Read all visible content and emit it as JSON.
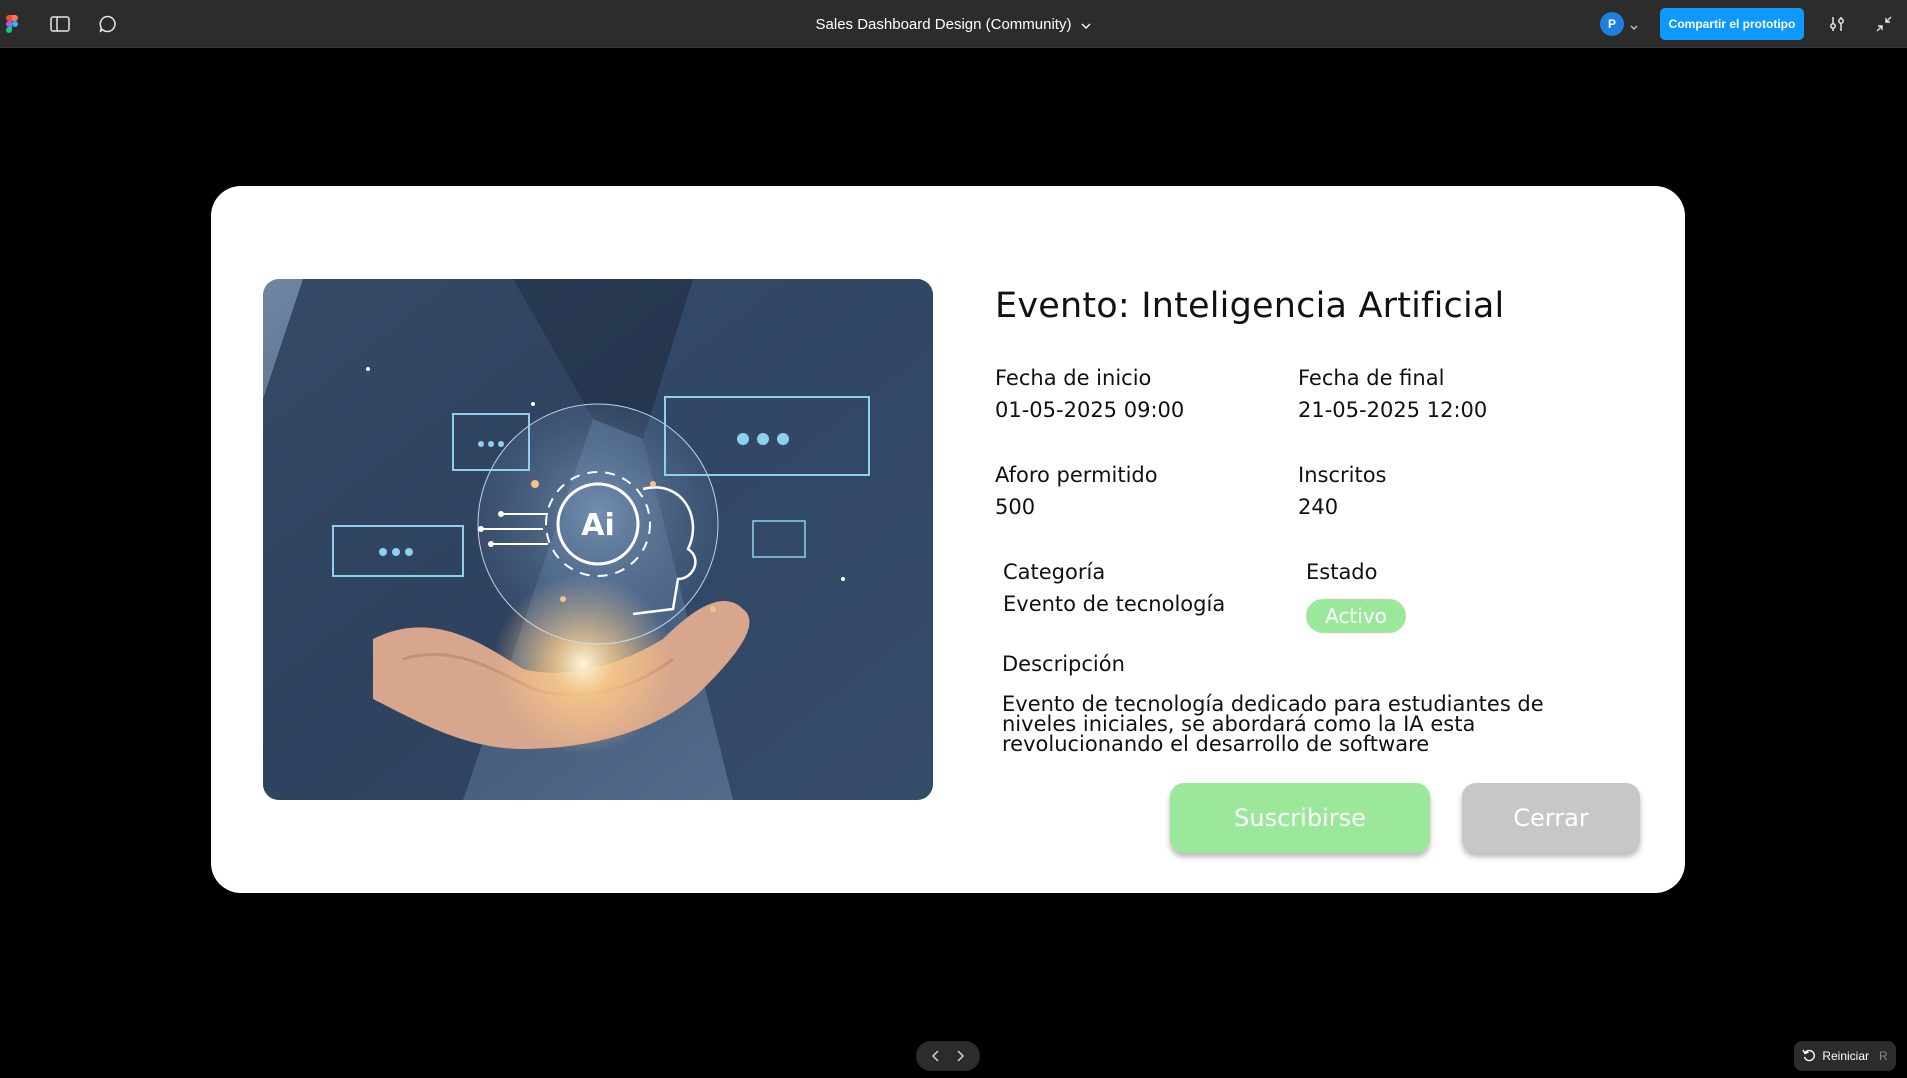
{
  "toolbar": {
    "file_title": "Sales Dashboard Design (Community)",
    "avatar_initial": "P",
    "share_label": "Compartir el prototipo"
  },
  "event": {
    "title": "Evento: Inteligencia Artificial",
    "start_label": "Fecha de inicio",
    "start_value": "01-05-2025 09:00",
    "end_label": "Fecha de final",
    "end_value": "21-05-2025 12:00",
    "capacity_label": "Aforo permitido",
    "capacity_value": "500",
    "enrolled_label": "Inscritos",
    "enrolled_value": "240",
    "category_label": "Categoría",
    "category_value": "Evento de tecnología",
    "status_label": "Estado",
    "status_value": "Activo",
    "description_label": "Descripción",
    "description_lines": [
      "Evento de tecnología dedicado para estudiantes de",
      "niveles iniciales, se abordará como la IA esta",
      "revolucionando el desarrollo de software"
    ],
    "hero_image_text": "Ai",
    "subscribe_label": "Suscribirse",
    "close_label": "Cerrar"
  },
  "footer": {
    "restart_label": "Reiniciar",
    "restart_shortcut": "R"
  },
  "colors": {
    "toolbar_bg": "#2c2c2c",
    "share_blue": "#0d99ff",
    "status_green": "#9be89b",
    "close_gray": "#c7c7c7",
    "canvas_bg": "#000000"
  },
  "icons": {
    "logo": "figma-logo-icon",
    "sidebar": "sidebar-panel-icon",
    "comment": "comment-icon",
    "title_chevron": "chevron-down-icon",
    "settings": "sliders-settings-icon",
    "collapse": "collapse-arrows-icon",
    "prev": "chevron-left-icon",
    "next": "chevron-right-icon",
    "restart": "restart-arrow-icon"
  }
}
